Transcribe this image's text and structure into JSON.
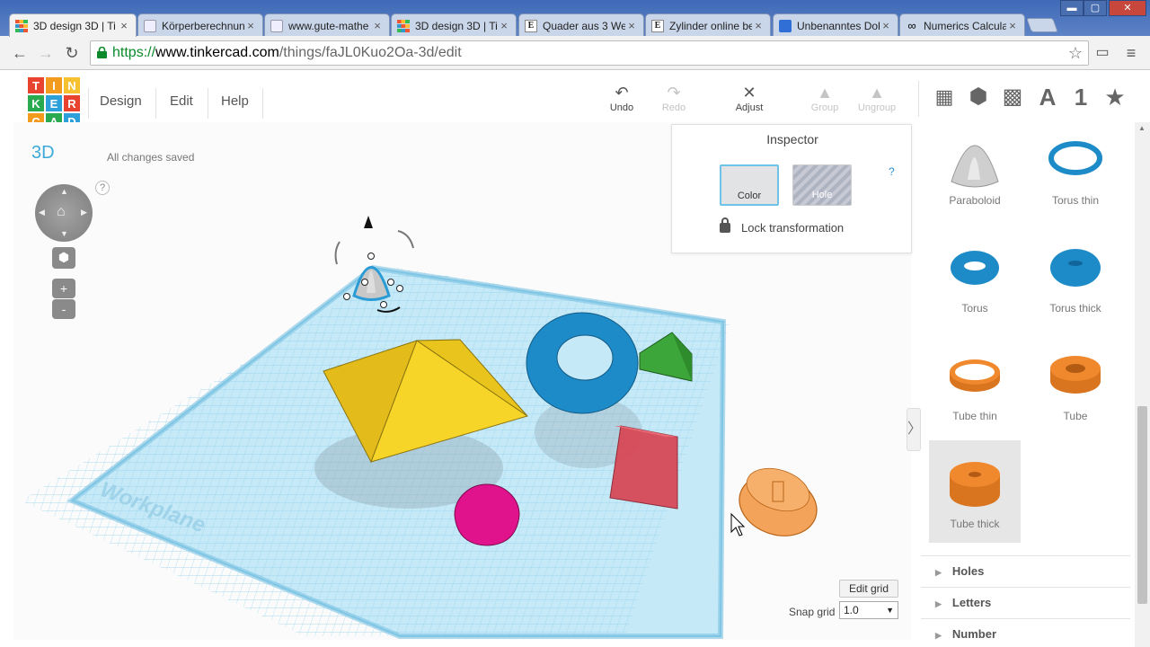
{
  "browser": {
    "tabs": [
      {
        "title": "3D design 3D | Ti",
        "icon": "tinkercad-favicon",
        "active": true
      },
      {
        "title": "Körperberechnung",
        "icon": "page-favicon"
      },
      {
        "title": "www.gute-mathe",
        "icon": "page-favicon"
      },
      {
        "title": "3D design 3D | Ti",
        "icon": "tinkercad-favicon"
      },
      {
        "title": "Quader aus 3 We",
        "icon": "e-favicon"
      },
      {
        "title": "Zylinder online be",
        "icon": "e-favicon"
      },
      {
        "title": "Unbenanntes Dok",
        "icon": "docs-favicon"
      },
      {
        "title": "Numerics Calculat",
        "icon": "infinity-favicon"
      }
    ],
    "close_glyph": "×",
    "window_controls": {
      "minimize": "▬",
      "maximize": "▢",
      "close": "✕"
    },
    "nav": {
      "back": "←",
      "forward": "→",
      "reload": "↻",
      "menu": "≡",
      "star": "☆",
      "cast": "▭"
    },
    "url": {
      "scheme": "https://",
      "host": "www.tinkercad.com",
      "path": "/things/faJL0Kuo2Oa-3d/edit"
    }
  },
  "app": {
    "logo_letters": [
      "T",
      "I",
      "N",
      "K",
      "E",
      "R",
      "C",
      "A",
      "D"
    ],
    "logo_colors": [
      "#e8432f",
      "#f29b1e",
      "#f6c130",
      "#2aaa4f",
      "#2d9fd9",
      "#e8432f",
      "#f29b1e",
      "#2aaa4f",
      "#2d9fd9"
    ],
    "menu": [
      "Design",
      "Edit",
      "Help"
    ],
    "tools": {
      "undo": {
        "label": "Undo",
        "icon": "↶"
      },
      "redo": {
        "label": "Redo",
        "icon": "↷"
      },
      "adjust": {
        "label": "Adjust",
        "icon": "✕"
      },
      "group": {
        "label": "Group",
        "icon": "▲"
      },
      "ungroup": {
        "label": "Ungroup",
        "icon": "▲"
      }
    },
    "shape_tabs": [
      "▦",
      "⬢",
      "▩",
      "A",
      "1",
      "★"
    ],
    "view_label": "3D",
    "save_status": "All changes saved",
    "help_glyph": "?",
    "zoom_in": "+",
    "zoom_out": "-",
    "workplane_label": "Workplane",
    "edit_grid": "Edit grid",
    "snap_grid_label": "Snap grid",
    "snap_grid_value": "1.0",
    "inspector": {
      "title": "Inspector",
      "color_label": "Color",
      "hole_label": "Hole",
      "help": "?",
      "lock_label": "Lock transformation"
    },
    "collapse_glyph": "〉",
    "colors": {
      "accent": "#3ba9d8",
      "workplane": "#bfe6f5",
      "pyramid": "#f2cd1e",
      "torus": "#1d8bc7",
      "box": "#d84553",
      "sphere": "#e0138c",
      "wedge": "#3da63a",
      "tube": "#f0892e"
    },
    "library": {
      "shapes": [
        {
          "name": "Paraboloid",
          "icon": "paraboloid-icon"
        },
        {
          "name": "Torus thin",
          "icon": "torus-thin-icon"
        },
        {
          "name": "Torus",
          "icon": "torus-icon"
        },
        {
          "name": "Torus thick",
          "icon": "torus-thick-icon"
        },
        {
          "name": "Tube thin",
          "icon": "tube-thin-icon"
        },
        {
          "name": "Tube",
          "icon": "tube-icon"
        },
        {
          "name": "Tube thick",
          "icon": "tube-thick-icon"
        }
      ],
      "categories": [
        "Holes",
        "Letters",
        "Number"
      ],
      "category_glyph": "▶"
    }
  }
}
